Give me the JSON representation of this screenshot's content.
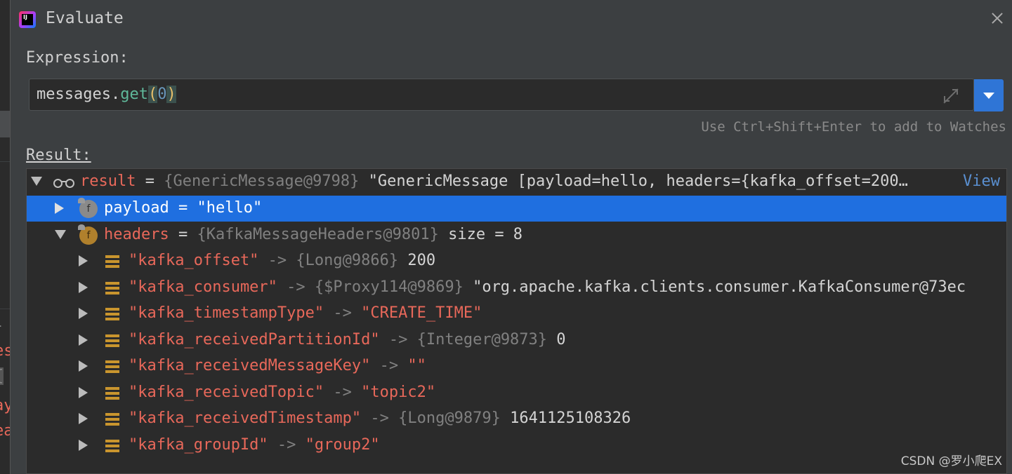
{
  "backdrop": {
    "glyphs": [
      "-",
      "es",
      "{",
      "ay",
      "ea"
    ]
  },
  "dialog": {
    "title": "Evaluate",
    "icon": "intellij-idea-icon",
    "close_icon": "close-icon"
  },
  "expression": {
    "label": "Expression:",
    "value_object": "messages",
    "value_dot": ".",
    "value_method": "get",
    "value_open": "(",
    "value_arg": "0",
    "value_close": ")",
    "expand_icon": "expand-icon",
    "history_icon": "dropdown-arrow-icon"
  },
  "hint": "Use Ctrl+Shift+Enter to add to Watches",
  "result": {
    "label": "Result:",
    "root": {
      "name": "result",
      "eq": " = ",
      "type": "{GenericMessage@9798}",
      "value": " \"GenericMessage [payload=hello, headers={kafka_offset=200…",
      "view_link": "View"
    },
    "payload": {
      "name": "payload",
      "eq": " = ",
      "value": "\"hello\""
    },
    "headers": {
      "name": "headers",
      "eq": " = ",
      "type": "{KafkaMessageHeaders@9801}",
      "size": "  size = 8"
    },
    "entries": [
      {
        "key": "\"kafka_offset\"",
        "arrow": " -> ",
        "type": "{Long@9866}",
        "value": " 200",
        "value_is_string": false
      },
      {
        "key": "\"kafka_consumer\"",
        "arrow": " -> ",
        "type": "{$Proxy114@9869}",
        "value": " \"org.apache.kafka.clients.consumer.KafkaConsumer@73ec",
        "value_is_string": false
      },
      {
        "key": "\"kafka_timestampType\"",
        "arrow": " -> ",
        "type": "",
        "value": "\"CREATE_TIME\"",
        "value_is_string": true
      },
      {
        "key": "\"kafka_receivedPartitionId\"",
        "arrow": " -> ",
        "type": "{Integer@9873}",
        "value": " 0",
        "value_is_string": false
      },
      {
        "key": "\"kafka_receivedMessageKey\"",
        "arrow": " -> ",
        "type": "",
        "value": "\"\"",
        "value_is_string": true
      },
      {
        "key": "\"kafka_receivedTopic\"",
        "arrow": " -> ",
        "type": "",
        "value": "\"topic2\"",
        "value_is_string": true
      },
      {
        "key": "\"kafka_receivedTimestamp\"",
        "arrow": " -> ",
        "type": "{Long@9879}",
        "value": " 1641125108326",
        "value_is_string": false
      },
      {
        "key": "\"kafka_groupId\"",
        "arrow": " -> ",
        "type": "",
        "value": "\"group2\"",
        "value_is_string": true
      }
    ]
  },
  "watermark": "CSDN @罗小爬EX",
  "colors": {
    "dialog_bg": "#3c3f41",
    "tree_bg": "#2b2b2b",
    "selection": "#1f6fe0",
    "string": "#e8685a",
    "type_gray": "#808080",
    "accent_button": "#2f75d6"
  }
}
